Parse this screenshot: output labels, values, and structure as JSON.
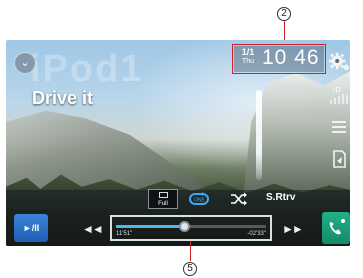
{
  "annotations": {
    "top_number": "2",
    "bottom_number": "5"
  },
  "source": {
    "watermark": "iPod1",
    "chevron_label": "⌄"
  },
  "track": {
    "title": "Drive it"
  },
  "clock": {
    "date": "1/1",
    "day": "Thu",
    "time": "10 46"
  },
  "side_icons": [
    "settings-icon",
    "equalizer-icon",
    "list-icon",
    "navigation-icon"
  ],
  "controls": {
    "full_label": "Full",
    "repeat_label": "repeat",
    "shuffle_label": "shuffle",
    "srtrv_label": "S.Rtrv"
  },
  "playback": {
    "play_pause_label": "►/II",
    "rewind_label": "◄◄",
    "forward_label": "►►",
    "elapsed": "11'51\"",
    "remaining": "-02'33\"",
    "progress": 0.45
  },
  "colors": {
    "accent_blue": "#1f5eb4",
    "progress_blue": "#52b7f0",
    "phone_green": "#148a6a",
    "callout_red": "#d21f26"
  }
}
